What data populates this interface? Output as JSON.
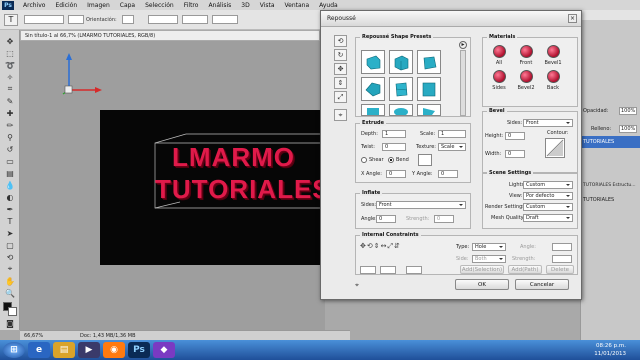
{
  "menubar": {
    "logo": "Ps",
    "items": [
      "Archivo",
      "Edición",
      "Imagen",
      "Capa",
      "Selección",
      "Filtro",
      "Análisis",
      "3D",
      "Vista",
      "Ventana",
      "Ayuda"
    ]
  },
  "options_bar": {
    "orientation_label": "Orientación:"
  },
  "document": {
    "tab_title": "Sin título-1 al 66,7% (LMARMO TUTORIALES, RGB/8)",
    "text_line1": "LMARMO",
    "text_line2": "TUTORIALES",
    "text_color": "#e01a4a"
  },
  "status": {
    "zoom": "66,67%",
    "doc_info": "Doc: 1,43 MB/1,36 MB"
  },
  "right_panel": {
    "opacity_label": "Opacidad:",
    "opacity_value": "100%",
    "fill_label": "Relleno:",
    "fill_value": "100%",
    "layer_names": [
      "TUTORIALES",
      "TUTORIALES Estructu...",
      "TUTORIALES"
    ]
  },
  "dialog": {
    "title": "Repoussé",
    "presets": {
      "title": "Repoussé Shape Presets"
    },
    "materials": {
      "title": "Materials",
      "items": [
        "All",
        "Front",
        "Bevel1",
        "Sides",
        "Bevel2",
        "Back"
      ]
    },
    "extrude": {
      "title": "Extrude",
      "depth_label": "Depth:",
      "depth_value": "1",
      "scale_label": "Scale:",
      "scale_value": "1",
      "twist_label": "Twist:",
      "twist_value": "0",
      "texture_label": "Texture:",
      "texture_value": "Scale",
      "shear_label": "Shear",
      "bend_label": "Bend",
      "xangle_label": "X Angle:",
      "xangle_value": "0",
      "yangle_label": "Y Angle:",
      "yangle_value": "0"
    },
    "inflate": {
      "title": "Inflate",
      "sides_label": "Sides:",
      "sides_value": "Front",
      "angle_label": "Angle:",
      "angle_value": "0",
      "strength_label": "Strength:",
      "strength_value": "0"
    },
    "bevel": {
      "title": "Bevel",
      "sides_label": "Sides:",
      "sides_value": "Front",
      "height_label": "Height:",
      "height_value": "0",
      "width_label": "Width:",
      "width_value": "0",
      "contour_label": "Contour:"
    },
    "scene": {
      "title": "Scene Settings",
      "lights_label": "Lights:",
      "lights_value": "Custom",
      "view_label": "View:",
      "view_value": "Por defecto",
      "render_label": "Render Settings:",
      "render_value": "Custom",
      "mesh_label": "Mesh Quality:",
      "mesh_value": "Draft"
    },
    "constraints": {
      "title": "Internal Constraints",
      "type_label": "Type:",
      "type_value": "Hole",
      "side_label": "Side:",
      "side_value": "Both",
      "angle_label": "Angle:",
      "strength_label": "Strength:",
      "add_selection": "Add(Selection)",
      "add_path": "Add(Path)",
      "delete": "Delete"
    },
    "ok": "OK",
    "cancel": "Cancelar"
  },
  "taskbar": {
    "time": "08:26 p.m.",
    "date": "11/01/2013"
  }
}
